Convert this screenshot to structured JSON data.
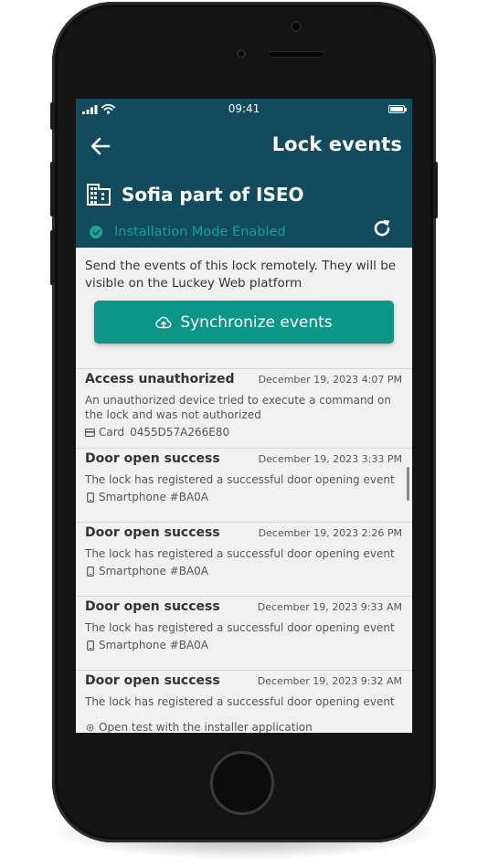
{
  "status_bar": {
    "time": "09:41"
  },
  "header": {
    "title": "Lock events",
    "site_name": "Sofia part of ISEO",
    "installation_status": "Installation Mode Enabled"
  },
  "sync": {
    "description": "Send the events of this lock remotely. They will be visible on the Luckey Web platform",
    "button_label": "Synchronize events"
  },
  "events": [
    {
      "title": "Access unauthorized",
      "date": "December 19, 2023 4:07 PM",
      "description": "An unauthorized device tried to execute a command on the lock and was not authorized",
      "meta_icon": "card-icon",
      "meta_label": "Card",
      "meta_value": "0455D57A266E80"
    },
    {
      "title": "Door open success",
      "date": "December 19, 2023 3:33 PM",
      "description": "The lock has registered a successful door opening event",
      "meta_icon": "smartphone-icon",
      "meta_label": "",
      "meta_value": "Smartphone #BA0A"
    },
    {
      "title": "Door open success",
      "date": "December 19, 2023 2:26 PM",
      "description": "The lock has registered a successful door opening event",
      "meta_icon": "smartphone-icon",
      "meta_label": "",
      "meta_value": "Smartphone #BA0A"
    },
    {
      "title": "Door open success",
      "date": "December 19, 2023 9:33 AM",
      "description": "The lock has registered a successful door opening event",
      "meta_icon": "smartphone-icon",
      "meta_label": "",
      "meta_value": "Smartphone #BA0A"
    },
    {
      "title": "Door open success",
      "date": "December 19, 2023 9:32 AM",
      "description": "The lock has registered a successful door opening event",
      "meta_icon": "gear-icon",
      "meta_label": "",
      "meta_value": "Open test with the installer application"
    }
  ],
  "colors": {
    "header_bg": "#124a5e",
    "accent": "#0b9688",
    "status_ok": "#1aa594"
  }
}
